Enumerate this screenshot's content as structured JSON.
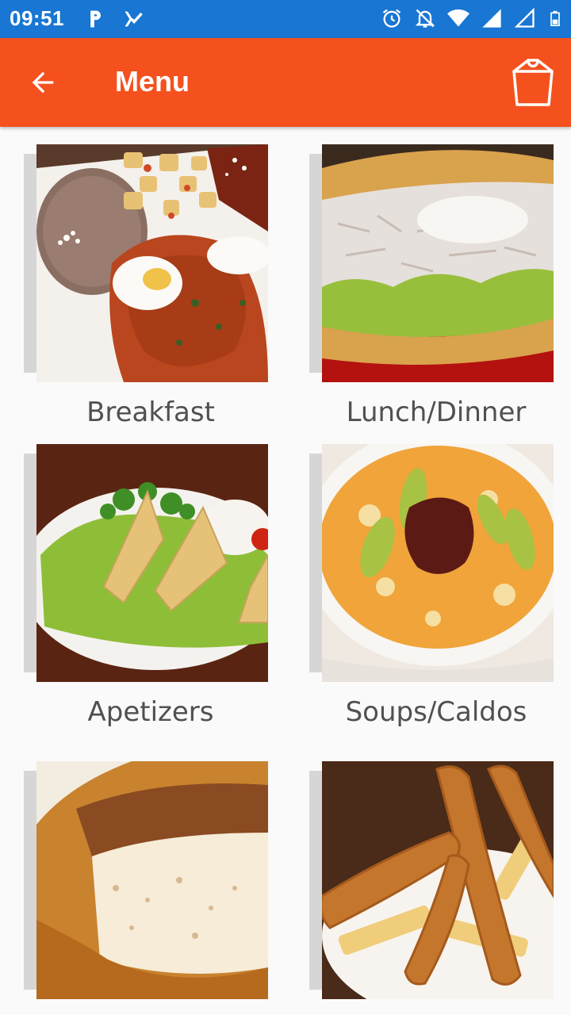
{
  "status_bar": {
    "time": "09:51",
    "left_icons": [
      "parking-app-icon",
      "task-app-icon"
    ],
    "right_icons": [
      "alarm-icon",
      "notifications-off-icon",
      "wifi-icon",
      "signal-icon",
      "signal-empty-icon",
      "battery-icon"
    ]
  },
  "app_bar": {
    "title": "Menu",
    "back_icon": "arrow-back-icon",
    "cart_icon": "shopping-bag-icon",
    "color": "#f4511e"
  },
  "categories": [
    {
      "label": "Breakfast",
      "image": "huevos-rancheros-photo"
    },
    {
      "label": "Lunch/Dinner",
      "image": "tostada-photo"
    },
    {
      "label": "Apetizers",
      "image": "guacamole-photo"
    },
    {
      "label": "Soups/Caldos",
      "image": "caldo-soup-photo"
    },
    {
      "label": "",
      "image": "flan-photo"
    },
    {
      "label": "",
      "image": "chicken-strips-photo"
    }
  ],
  "colors": {
    "status_bar": "#1976d2",
    "app_bar": "#f4511e",
    "background": "#fafafa"
  }
}
